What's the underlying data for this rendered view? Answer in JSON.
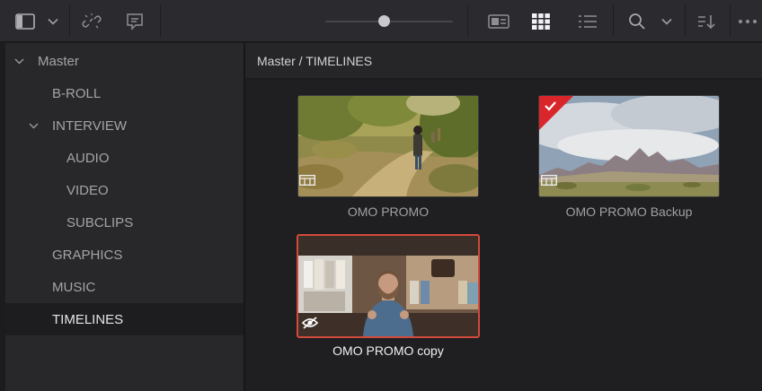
{
  "toolbar": {
    "icons": [
      "sidebar-toggle-icon",
      "chevron-down-icon",
      "unlink-icon",
      "caption-icon",
      "metadata-view-icon",
      "thumbnail-grid-icon",
      "list-view-icon",
      "search-icon",
      "sort-icon",
      "more-icon"
    ],
    "active_view": "thumbnail-grid",
    "zoom_level": 0.42
  },
  "sidebar": {
    "root": {
      "label": "Master"
    },
    "items": [
      {
        "label": "B-ROLL",
        "level": 1
      },
      {
        "label": "INTERVIEW",
        "level": 1,
        "expanded": true
      },
      {
        "label": "AUDIO",
        "level": 2
      },
      {
        "label": "VIDEO",
        "level": 2
      },
      {
        "label": "SUBCLIPS",
        "level": 2
      },
      {
        "label": "GRAPHICS",
        "level": 1
      },
      {
        "label": "MUSIC",
        "level": 1
      },
      {
        "label": "TIMELINES",
        "level": 1,
        "selected": true
      }
    ]
  },
  "main": {
    "breadcrumb": "Master / TIMELINES",
    "clips": [
      {
        "label": "OMO PROMO",
        "type_icon": "timeline-icon"
      },
      {
        "label": "OMO PROMO Backup",
        "type_icon": "timeline-icon",
        "flagged": true,
        "flag_color": "#d8262b"
      },
      {
        "label": "OMO PROMO copy",
        "type_icon": "hidden-eye-icon",
        "selected": true,
        "selection_color": "#d24a3c"
      }
    ]
  },
  "colors": {
    "selection": "#d24a3c",
    "flag": "#d8262b",
    "background": "#1f1f21",
    "sidebar": "#28282b"
  }
}
